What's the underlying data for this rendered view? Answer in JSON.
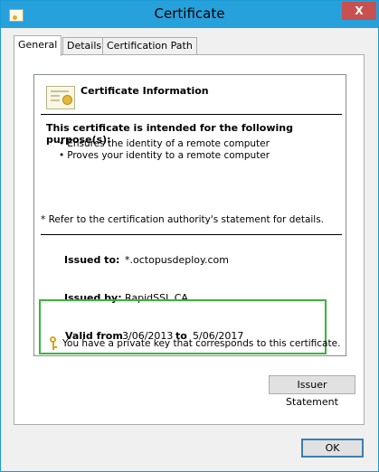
{
  "window": {
    "title": "Certificate",
    "close_label": "X"
  },
  "tabs": [
    {
      "label": "General"
    },
    {
      "label": "Details"
    },
    {
      "label": "Certification Path"
    }
  ],
  "cert": {
    "info_title": "Certificate Information",
    "purpose_heading": "This certificate is intended for the following purpose(s):",
    "purposes": [
      "Ensures the identity of a remote computer",
      "Proves your identity to a remote computer"
    ],
    "refer_note": "* Refer to the certification authority's statement for details.",
    "issued_to_label": "Issued to:",
    "issued_to": "*.octopusdeploy.com",
    "issued_by_label": "Issued by:",
    "issued_by": "RapidSSL CA",
    "valid_from_label": "Valid from",
    "valid_from": "3/06/2013",
    "to_label": "to",
    "valid_to": "5/06/2017",
    "private_key_note": "You have a private key that corresponds to this certificate."
  },
  "buttons": {
    "issuer_statement": "Issuer Statement",
    "ok": "OK"
  },
  "colors": {
    "titlebar": "#27a1db",
    "close": "#c75050",
    "highlight": "#3ab43a"
  }
}
